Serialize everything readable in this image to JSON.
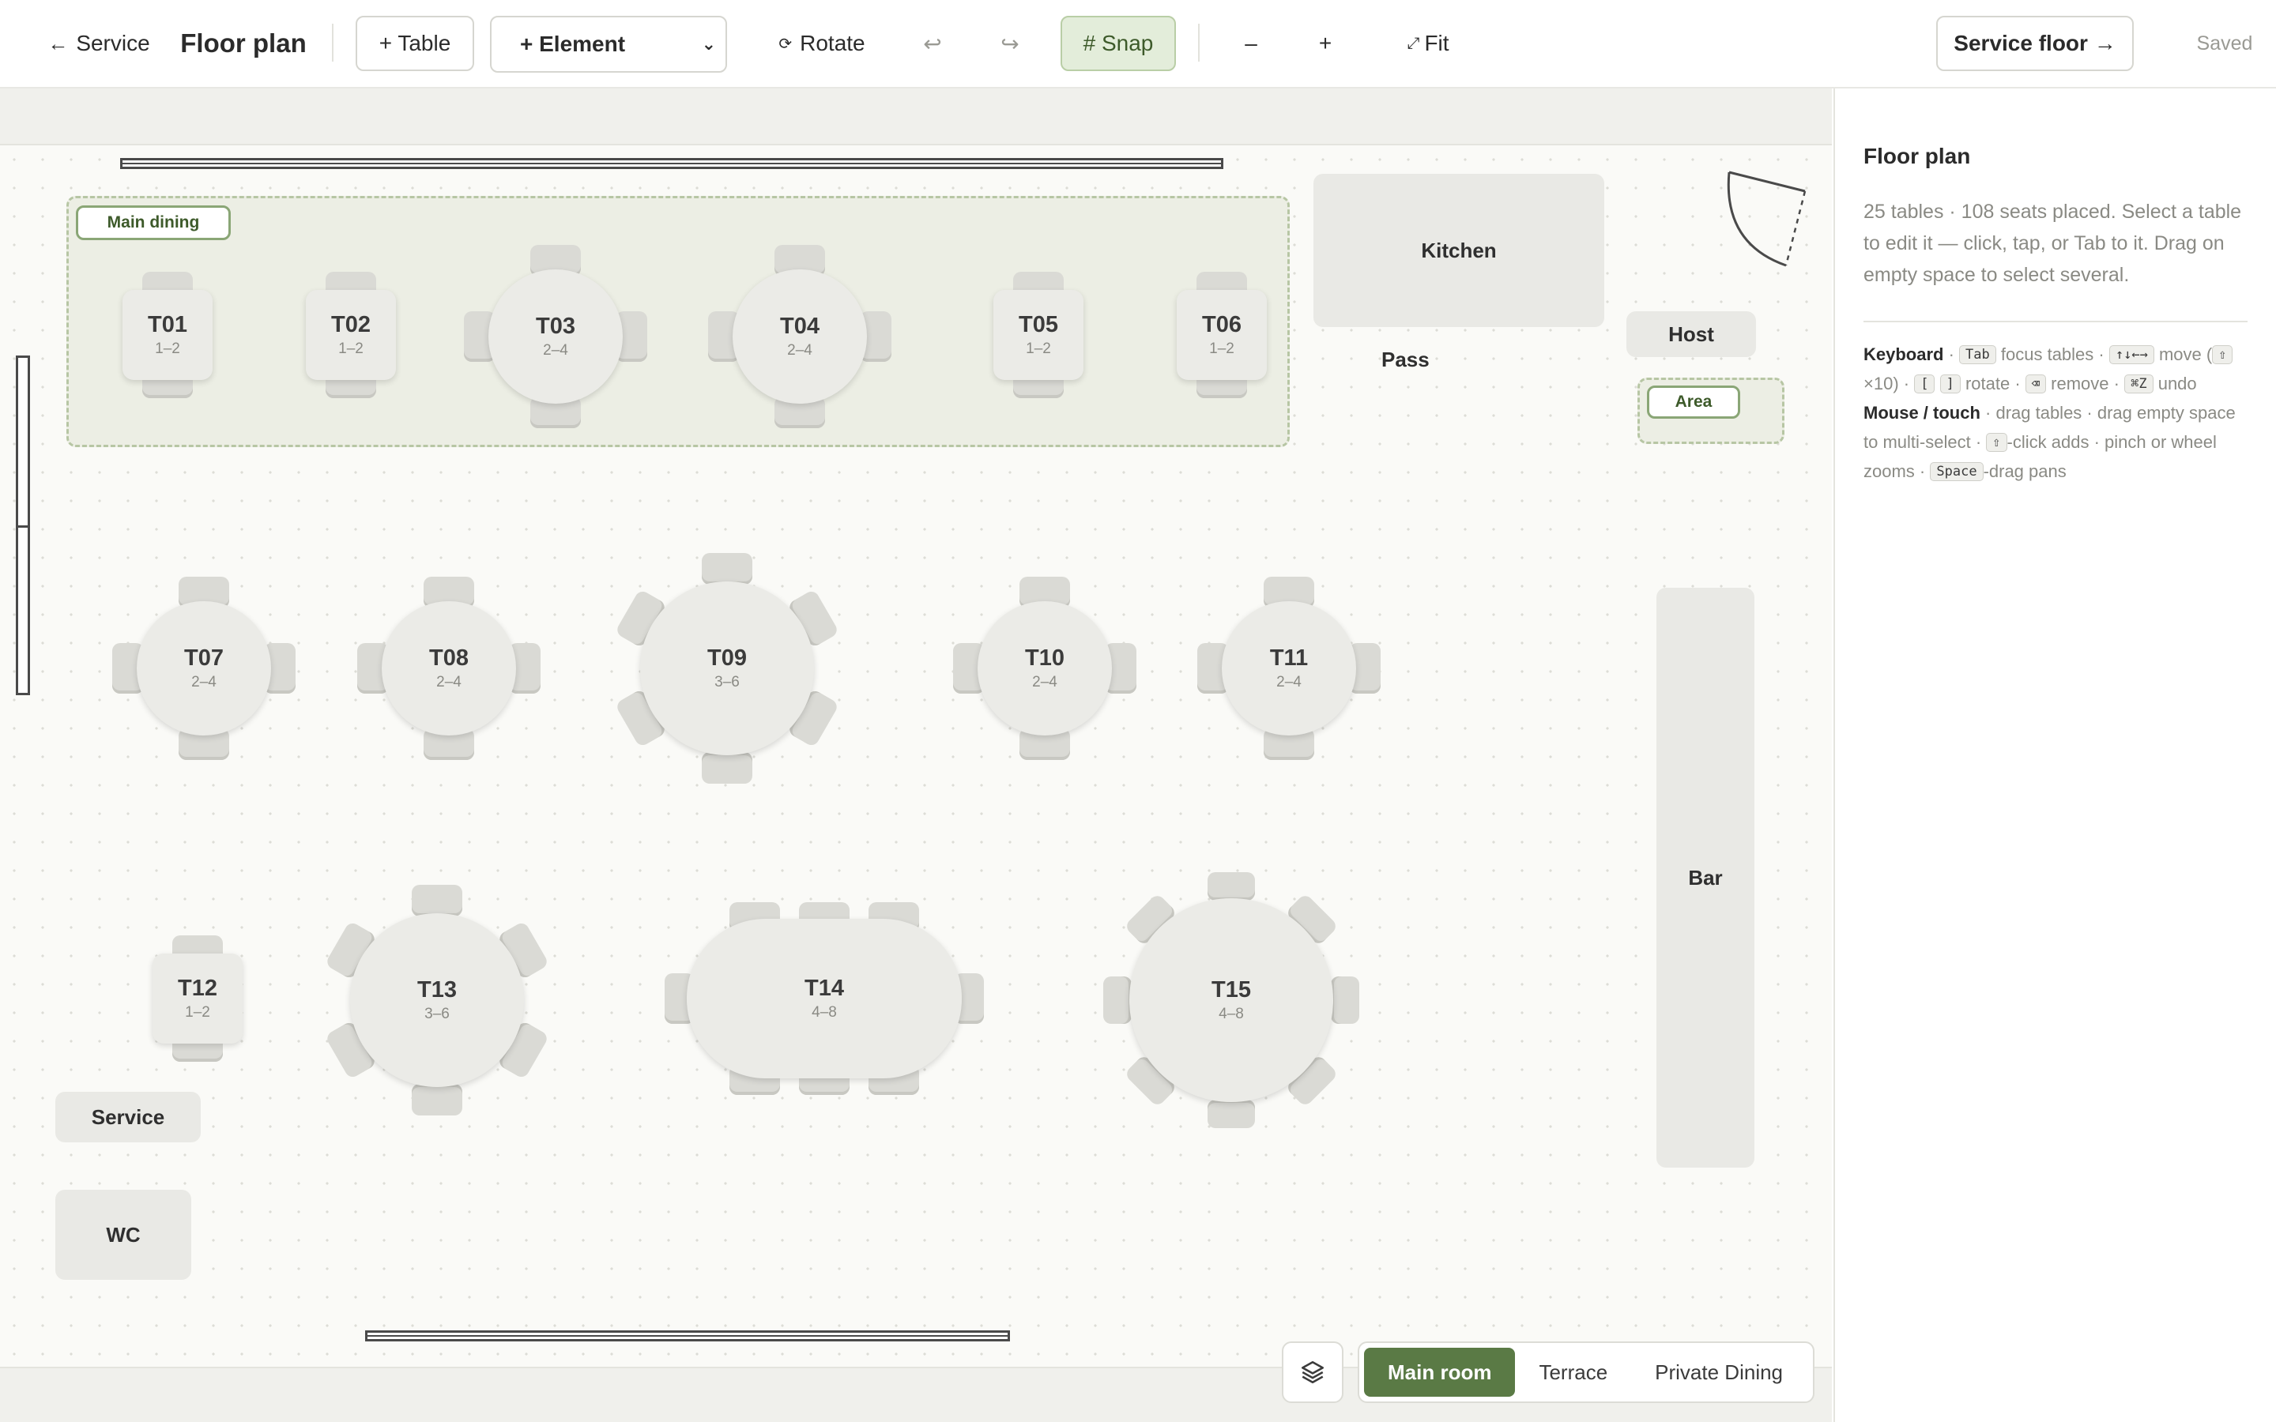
{
  "toolbar": {
    "back_label": "Service",
    "title": "Floor plan",
    "add_table_label": "+ Table",
    "add_element_label": "+ Element",
    "rotate_label": "Rotate",
    "undo_icon": "undo-icon",
    "redo_icon": "redo-icon",
    "snap_label": "# Snap",
    "zoom_out_label": "–",
    "zoom_in_label": "+",
    "fit_label": "Fit",
    "service_floor_label": "Service floor →",
    "status": "Saved"
  },
  "areas": [
    {
      "label": "Main dining"
    },
    {
      "label": "Area"
    }
  ],
  "fixtures": {
    "kitchen": "Kitchen",
    "pass": "Pass",
    "host": "Host",
    "bar": "Bar",
    "service": "Service",
    "wc": "WC"
  },
  "tables": [
    {
      "name": "T01",
      "capacity": "1–2",
      "shape": "square"
    },
    {
      "name": "T02",
      "capacity": "1–2",
      "shape": "square"
    },
    {
      "name": "T03",
      "capacity": "2–4",
      "shape": "round"
    },
    {
      "name": "T04",
      "capacity": "2–4",
      "shape": "round"
    },
    {
      "name": "T05",
      "capacity": "1–2",
      "shape": "square"
    },
    {
      "name": "T06",
      "capacity": "1–2",
      "shape": "square"
    },
    {
      "name": "T07",
      "capacity": "2–4",
      "shape": "round"
    },
    {
      "name": "T08",
      "capacity": "2–4",
      "shape": "round"
    },
    {
      "name": "T09",
      "capacity": "3–6",
      "shape": "round"
    },
    {
      "name": "T10",
      "capacity": "2–4",
      "shape": "round"
    },
    {
      "name": "T11",
      "capacity": "2–4",
      "shape": "round"
    },
    {
      "name": "T12",
      "capacity": "1–2",
      "shape": "square"
    },
    {
      "name": "T13",
      "capacity": "3–6",
      "shape": "round"
    },
    {
      "name": "T14",
      "capacity": "4–8",
      "shape": "oval"
    },
    {
      "name": "T15",
      "capacity": "4–8",
      "shape": "round"
    }
  ],
  "room_tabs": [
    {
      "label": "Main room",
      "active": true
    },
    {
      "label": "Terrace",
      "active": false
    },
    {
      "label": "Private Dining",
      "active": false
    }
  ],
  "panel": {
    "title": "Floor plan",
    "summary": "25 tables · 108 seats placed. Select a table to edit it — click, tap, or Tab to it. Drag on empty space to select several.",
    "keyboard_heading": "Keyboard",
    "key_tab": "Tab",
    "kb_focus": "focus tables ·",
    "key_arrows": "↑↓←→",
    "kb_move": "move",
    "key_shift": "⇧",
    "kb_x10": "×10) ·",
    "key_bracket_open": "[",
    "key_bracket_close": "]",
    "kb_rotate": "rotate ·",
    "key_delete": "⌫",
    "kb_remove": "remove ·",
    "key_undo": "⌘Z",
    "kb_undo": "undo",
    "mouse_heading": "Mouse / touch",
    "mouse_text1": "· drag tables · drag empty space to multi-select ·",
    "key_shift2": "⇧",
    "mouse_text2": "-click adds · pinch or wheel zooms ·",
    "key_space": "Space",
    "mouse_text3": "-drag pans"
  }
}
